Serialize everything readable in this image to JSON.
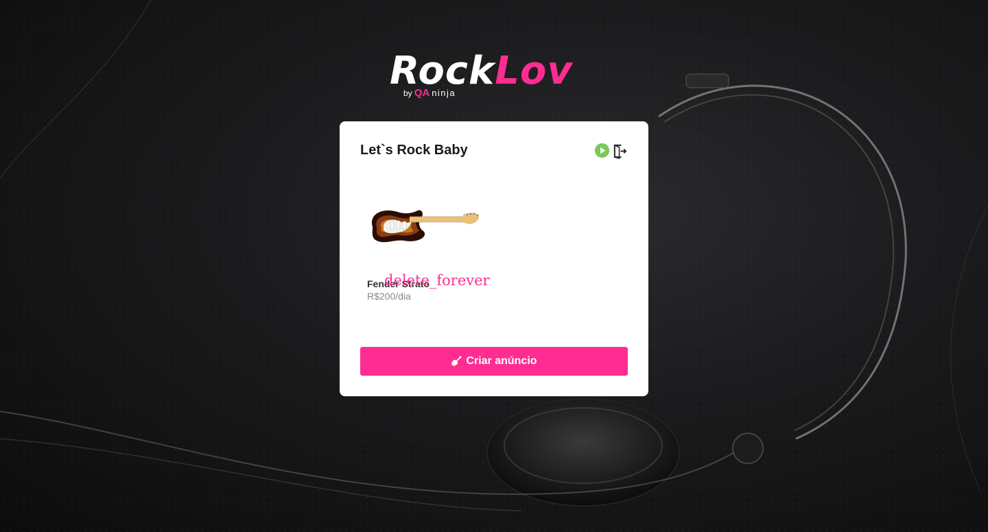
{
  "logo": {
    "primary": "Rock",
    "accent": "Lov",
    "by": "by",
    "qa_mark": "QA",
    "brand": "ninja"
  },
  "card": {
    "title": "Let`s Rock Baby",
    "icons": {
      "play": "play-circle-icon",
      "logout": "logout-icon"
    }
  },
  "listing": {
    "name": "Fender Strato",
    "price": "R$200/dia",
    "delete_label": "delete_forever",
    "image_alt": "electric-guitar-image"
  },
  "create_button": {
    "label": "Criar anúncio",
    "icon": "guitar-icon"
  },
  "colors": {
    "accent": "#ff2d92",
    "play": "#7bc95c",
    "background": "#1a1a1c",
    "card": "#ffffff"
  }
}
